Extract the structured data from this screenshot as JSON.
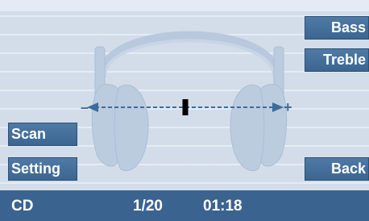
{
  "buttons": {
    "bass": "Bass",
    "treble": "Treble",
    "scan": "Scan",
    "setting": "Setting",
    "back": "Back"
  },
  "balance": {
    "min_symbol": "–",
    "max_symbol": "+",
    "level": 0.5
  },
  "status": {
    "source": "CD",
    "track": "1/20",
    "time": "01:18"
  },
  "colors": {
    "accent": "#3b6590",
    "background": "#d3dde9",
    "statusbar": "#3a6390",
    "indicator": "#000000"
  },
  "icons": {
    "headphones": "headphones-icon"
  }
}
